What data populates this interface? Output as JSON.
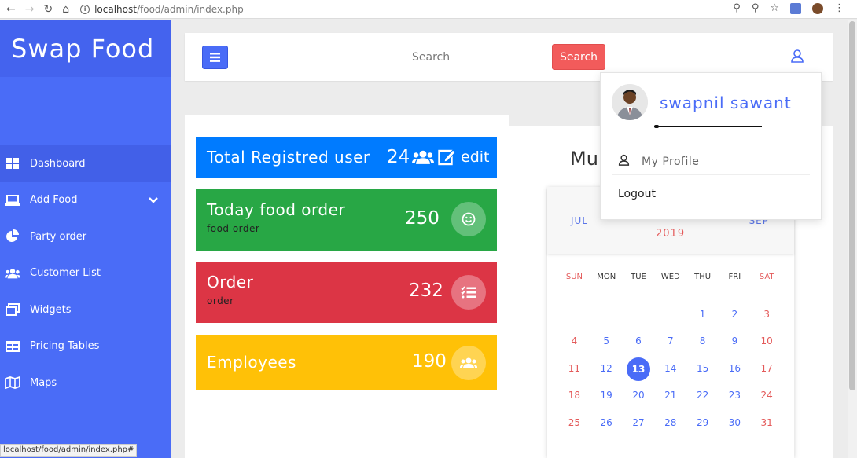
{
  "browser": {
    "url_host": "localhost",
    "url_path": "/food/admin/index.php",
    "status_url": "localhost/food/admin/index.php#"
  },
  "sidebar": {
    "brand": "Swap Food",
    "items": [
      {
        "label": "Dashboard",
        "icon": "grid-icon"
      },
      {
        "label": "Add Food",
        "icon": "laptop-icon"
      },
      {
        "label": "Party order",
        "icon": "pie-chart-icon"
      },
      {
        "label": "Customer List",
        "icon": "users-icon"
      },
      {
        "label": "Widgets",
        "icon": "windows-icon"
      },
      {
        "label": "Pricing Tables",
        "icon": "table-icon"
      },
      {
        "label": "Maps",
        "icon": "map-icon"
      }
    ]
  },
  "topbar": {
    "search_placeholder": "Search",
    "search_button": "Search"
  },
  "stats": {
    "registered": {
      "title": "Total Registred user",
      "count": "24",
      "action": "edit",
      "color": "#007bff"
    },
    "today_order": {
      "title": "Today food order",
      "subtitle": "food order",
      "count": "250",
      "color": "#28a745"
    },
    "order": {
      "title": "Order",
      "subtitle": "order",
      "count": "232",
      "color": "#dc3545"
    },
    "employees": {
      "title": "Employees",
      "count": "190",
      "color": "#ffc107"
    }
  },
  "right_panel": {
    "title_partial": "Mu"
  },
  "calendar": {
    "prev_month": "JUL",
    "next_month": "SEP",
    "year": "2019",
    "weekdays": [
      "SUN",
      "MON",
      "TUE",
      "WED",
      "THU",
      "FRI",
      "SAT"
    ],
    "weeks": [
      [
        "",
        "",
        "",
        "",
        "1",
        "2",
        "3"
      ],
      [
        "4",
        "5",
        "6",
        "7",
        "8",
        "9",
        "10"
      ],
      [
        "11",
        "12",
        "13",
        "14",
        "15",
        "16",
        "17"
      ],
      [
        "18",
        "19",
        "20",
        "21",
        "22",
        "23",
        "24"
      ],
      [
        "25",
        "26",
        "27",
        "28",
        "29",
        "30",
        "31"
      ]
    ],
    "today": "13"
  },
  "profile_menu": {
    "username": "swapnil sawant",
    "my_profile": "My Profile",
    "logout": "Logout"
  },
  "colors": {
    "accent": "#4a6cf7",
    "danger": "#f25b5b"
  }
}
